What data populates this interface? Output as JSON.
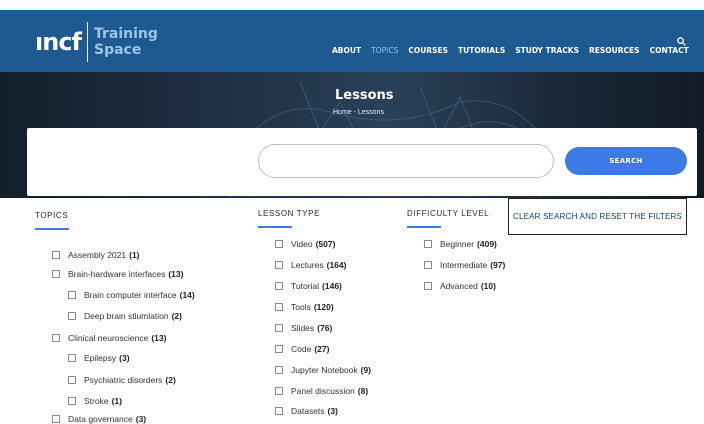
{
  "header": {
    "logo_mark": "ıncf",
    "logo_sub_1": "Training",
    "logo_sub_2": "Space",
    "nav": [
      {
        "label": "ABOUT",
        "active": false
      },
      {
        "label": "TOPICS",
        "active": true
      },
      {
        "label": "COURSES",
        "active": false
      },
      {
        "label": "TUTORIALS",
        "active": false
      },
      {
        "label": "STUDY TRACKS",
        "active": false
      },
      {
        "label": "RESOURCES",
        "active": false
      },
      {
        "label": "CONTACT",
        "active": false
      }
    ],
    "search_icon": "search-icon"
  },
  "banner": {
    "title": "Lessons",
    "breadcrumb": "Home - Lessons"
  },
  "search": {
    "value": "",
    "button_label": "SEARCH"
  },
  "filters": {
    "topics": {
      "heading": "TOPICS",
      "items": [
        {
          "label": "Assembly 2021",
          "count": "(1)",
          "level": 0
        },
        {
          "label": "Brain-hardware interfaces",
          "count": "(13)",
          "level": 0
        },
        {
          "label": "Brain computer interface",
          "count": "(14)",
          "level": 1
        },
        {
          "label": "Deep brain stiumlation",
          "count": "(2)",
          "level": 1
        },
        {
          "label": "Clinical neuroscience",
          "count": "(13)",
          "level": 0
        },
        {
          "label": "Epilepsy",
          "count": "(3)",
          "level": 1
        },
        {
          "label": "Psychiatric disorders",
          "count": "(2)",
          "level": 1
        },
        {
          "label": "Stroke",
          "count": "(1)",
          "level": 1
        },
        {
          "label": "Data governance",
          "count": "(3)",
          "level": 0
        }
      ]
    },
    "lesson_type": {
      "heading": "LESSON TYPE",
      "items": [
        {
          "label": "Video",
          "count": "(507)"
        },
        {
          "label": "Lectures",
          "count": "(164)"
        },
        {
          "label": "Tutorial",
          "count": "(146)"
        },
        {
          "label": "Tools",
          "count": "(120)"
        },
        {
          "label": "Slides",
          "count": "(76)"
        },
        {
          "label": "Code",
          "count": "(27)"
        },
        {
          "label": "Jupyter Notebook",
          "count": "(9)"
        },
        {
          "label": "Panel discussion",
          "count": "(8)"
        },
        {
          "label": "Datasets",
          "count": "(3)"
        }
      ]
    },
    "difficulty": {
      "heading": "DIFFICULTY LEVEL",
      "items": [
        {
          "label": "Beginner",
          "count": "(409)"
        },
        {
          "label": "Intermediate",
          "count": "(97)"
        },
        {
          "label": "Advanced",
          "count": "(10)"
        }
      ]
    },
    "reset_label": "CLEAR SEARCH AND RESET THE FILTERS"
  },
  "colors": {
    "navbar": "#1e5a91",
    "accent": "#3c7ae6",
    "active_nav": "#8ec6f2"
  }
}
